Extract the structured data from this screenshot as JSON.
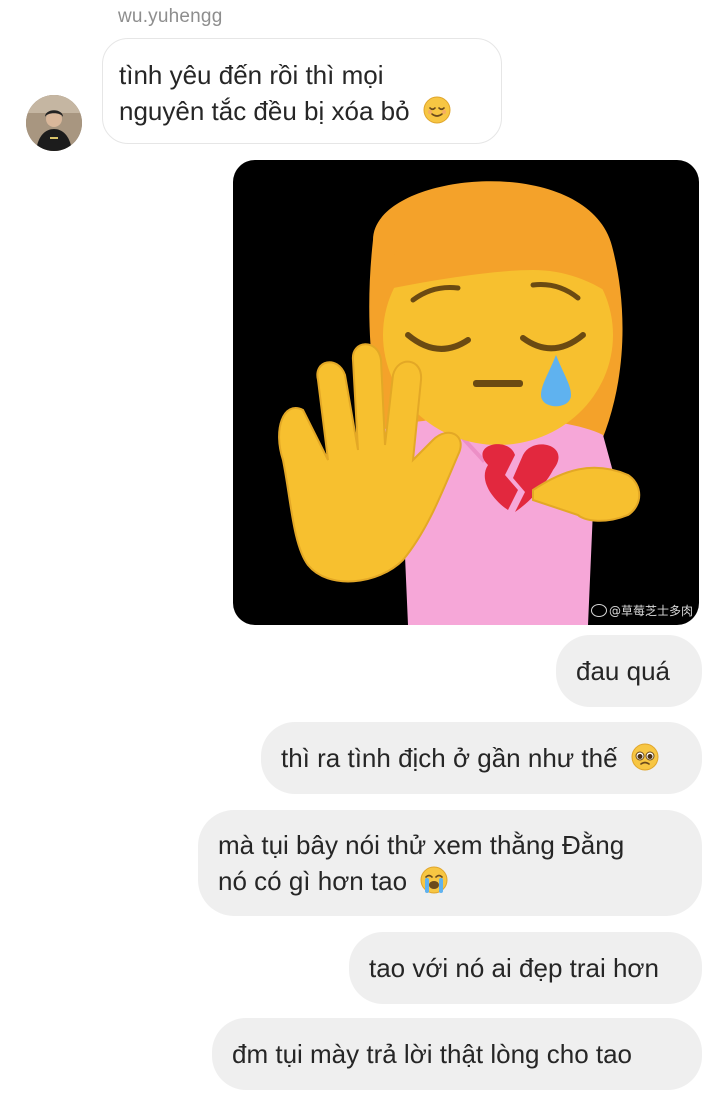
{
  "thread": {
    "sender_name": "wu.yuhengg"
  },
  "messages": {
    "incoming_1": {
      "line1": "tình yêu đến rồi thì mọi",
      "line2": "nguyên tắc đều bị xóa bỏ",
      "emoji": "relieved-face-icon"
    },
    "sticker": {
      "description_icon": "pensive-girl-stop-hand-broken-heart-sticker",
      "watermark_text": "@草莓芝士多肉"
    },
    "outgoing_1": {
      "text": "đau quá"
    },
    "outgoing_2": {
      "text": "thì ra tình địch ở gần như thế",
      "emoji": "pleading-face-icon"
    },
    "outgoing_3": {
      "line1": "mà tụi bây nói thử xem thằng Đằng",
      "line2": "nó có gì hơn tao",
      "emoji": "loudly-crying-face-icon"
    },
    "outgoing_4": {
      "text": "tao với nó ai đẹp trai hơn"
    },
    "outgoing_5": {
      "text": "đm tụi mày trả lời thật lòng cho tao"
    }
  },
  "colors": {
    "incoming_border": "#e6e6e6",
    "outgoing_bg": "#efefef",
    "text": "#262626",
    "sender_name": "#8e8e8e"
  }
}
